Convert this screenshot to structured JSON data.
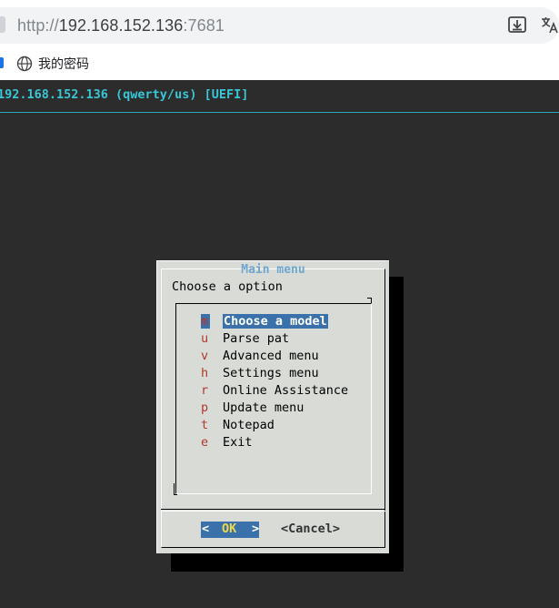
{
  "browser": {
    "url_protocol": "http://",
    "url_host": "192.168.152.136",
    "url_port": ":7681",
    "bookmark_label": "我的密码"
  },
  "terminal": {
    "header": "192.168.152.136 (qwerty/us) [UEFI]",
    "colors": {
      "background": "#2c2c2c",
      "header": "#38c7d6"
    }
  },
  "dialog": {
    "title": "Main menu",
    "prompt": "Choose a option",
    "items": [
      {
        "key": "m",
        "label": "Choose a model",
        "selected": true
      },
      {
        "key": "u",
        "label": "Parse pat"
      },
      {
        "key": "v",
        "label": "Advanced menu"
      },
      {
        "key": "h",
        "label": "Settings menu"
      },
      {
        "key": "r",
        "label": "Online Assistance"
      },
      {
        "key": "p",
        "label": "Update menu"
      },
      {
        "key": "t",
        "label": "Notepad"
      },
      {
        "key": "e",
        "label": "Exit"
      }
    ],
    "ok_label": "OK",
    "ok_left": "<",
    "ok_right": ">",
    "cancel_label": "<Cancel>",
    "colors": {
      "face": "#d9dcd6",
      "selection": "#3b71aa",
      "hotkey": "#b0382e",
      "title": "#6fa6cf"
    }
  }
}
